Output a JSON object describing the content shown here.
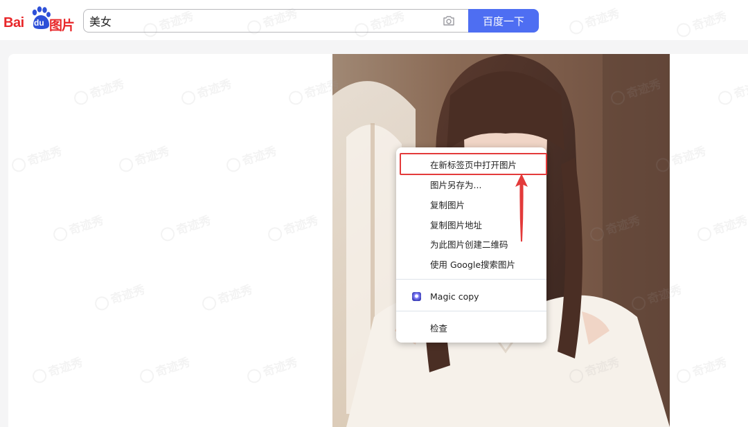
{
  "header": {
    "logo_text_bai": "Bai",
    "logo_text_du": "du",
    "logo_text_tupian": "图片",
    "search_value": "美女",
    "search_button_label": "百度一下",
    "brand_red": "#e8272a",
    "accent_blue": "#4e6ef2"
  },
  "context_menu": {
    "items": [
      {
        "label": "在新标签页中打开图片",
        "highlighted": true
      },
      {
        "label": "图片另存为..."
      },
      {
        "label": "复制图片"
      },
      {
        "label": "复制图片地址"
      },
      {
        "label": "为此图片创建二维码"
      },
      {
        "label": "使用 Google搜索图片"
      },
      {
        "label": "Magic copy",
        "icon": "magic-copy-icon"
      },
      {
        "label": "检查"
      }
    ],
    "highlight_color": "#e33a3a"
  },
  "watermark_text": "奇迹秀",
  "icons": {
    "camera": "camera-icon",
    "arrow": "red-arrow-up-icon"
  }
}
